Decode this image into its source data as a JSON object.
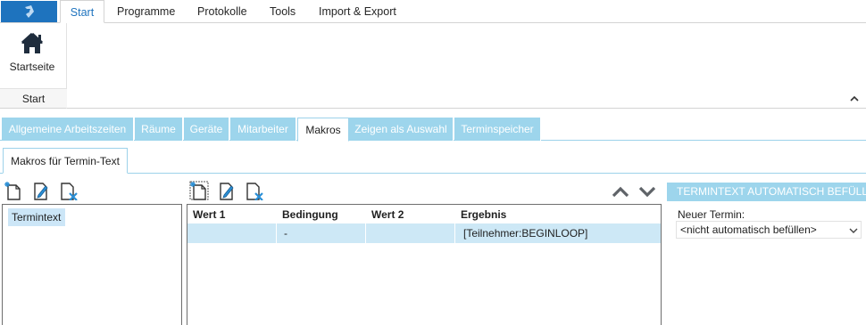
{
  "ribbon": {
    "tabs": [
      {
        "label": "Start",
        "active": true
      },
      {
        "label": "Programme",
        "active": false
      },
      {
        "label": "Protokolle",
        "active": false
      },
      {
        "label": "Tools",
        "active": false
      },
      {
        "label": "Import & Export",
        "active": false
      }
    ],
    "home_button_label": "Startseite",
    "group_label": "Start"
  },
  "content_tabs": [
    {
      "label": "Allgemeine Arbeitszeiten",
      "active": false
    },
    {
      "label": "Räume",
      "active": false
    },
    {
      "label": "Geräte",
      "active": false
    },
    {
      "label": "Mitarbeiter",
      "active": false
    },
    {
      "label": "Makros",
      "active": true
    },
    {
      "label": "Zeigen als Auswahl",
      "active": false
    },
    {
      "label": "Terminspeicher",
      "active": false
    }
  ],
  "sub_tab": {
    "label": "Makros für Termin-Text"
  },
  "macro_list": {
    "items": [
      {
        "label": "Termintext",
        "selected": true
      }
    ]
  },
  "grid": {
    "columns": [
      "Wert 1",
      "Bedingung",
      "Wert 2",
      "Ergebnis"
    ],
    "rows": [
      {
        "wert1": "",
        "bedingung": "-",
        "wert2": "",
        "ergebnis": "[Teilnehmer:BEGINLOOP]"
      }
    ]
  },
  "auto_fill": {
    "header": "TERMINTEXT AUTOMATISCH BEFÜLLEN",
    "label": "Neuer Termin:",
    "select_value": "<nicht automatisch befüllen>"
  },
  "colors": {
    "accent": "#1e73be",
    "tab_inactive": "#9dd5ec",
    "selection": "#cde8f6"
  },
  "icons": [
    "app-logo-icon",
    "home-icon",
    "new-document-icon",
    "edit-document-icon",
    "delete-document-icon",
    "move-up-icon",
    "move-down-icon",
    "collapse-ribbon-icon",
    "dropdown-arrow-icon"
  ]
}
